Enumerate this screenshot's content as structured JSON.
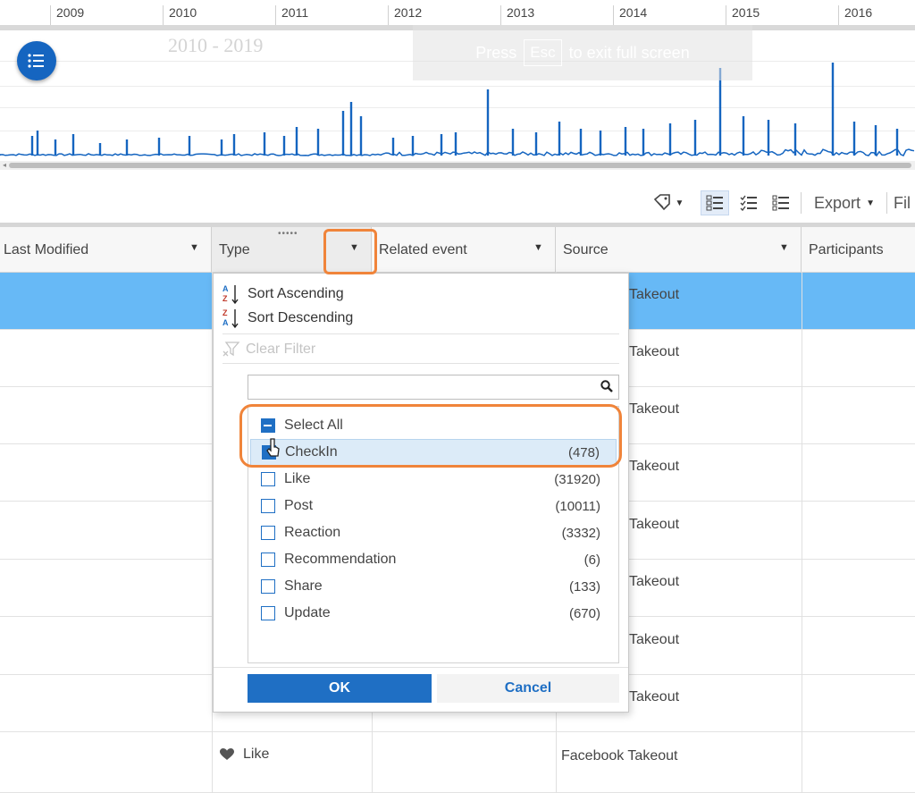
{
  "timeline": {
    "years": [
      "2009",
      "2010",
      "2011",
      "2012",
      "2013",
      "2014",
      "2015",
      "2016"
    ],
    "period_label": "2010 - 2019",
    "fullscreen_hint": {
      "before": "Press",
      "key": "Esc",
      "after": "to exit full screen"
    },
    "series_color": "#1565c0",
    "accent": "#1565c0"
  },
  "toolbar": {
    "tag_icon": "tag-icon",
    "view_icons": [
      "detail-list-icon",
      "checklist-icon",
      "list-view-icon"
    ],
    "export_label": "Export",
    "filter_label": "Fil"
  },
  "grid": {
    "columns": [
      {
        "label": "Last Modified"
      },
      {
        "label": "Type"
      },
      {
        "label": "Related event"
      },
      {
        "label": "Source"
      },
      {
        "label": "Participants"
      }
    ],
    "selected_row_color": "#67b9f6",
    "source_fragment": "Takeout",
    "last_row": {
      "type": "Like",
      "type_icon": "heart-icon",
      "source": "Facebook Takeout"
    }
  },
  "filter_menu": {
    "sort_ascending": "Sort Ascending",
    "sort_descending": "Sort Descending",
    "clear_filter": "Clear Filter",
    "search_placeholder": "",
    "select_all": "Select All",
    "options": [
      {
        "label": "CheckIn",
        "count": "(478)",
        "state": "checked"
      },
      {
        "label": "Like",
        "count": "(31920)",
        "state": "unchecked"
      },
      {
        "label": "Post",
        "count": "(10011)",
        "state": "unchecked"
      },
      {
        "label": "Reaction",
        "count": "(3332)",
        "state": "unchecked"
      },
      {
        "label": "Recommendation",
        "count": "(6)",
        "state": "unchecked"
      },
      {
        "label": "Share",
        "count": "(133)",
        "state": "unchecked"
      },
      {
        "label": "Update",
        "count": "(670)",
        "state": "unchecked"
      }
    ],
    "ok_label": "OK",
    "cancel_label": "Cancel",
    "highlight_color": "#f0843a"
  }
}
